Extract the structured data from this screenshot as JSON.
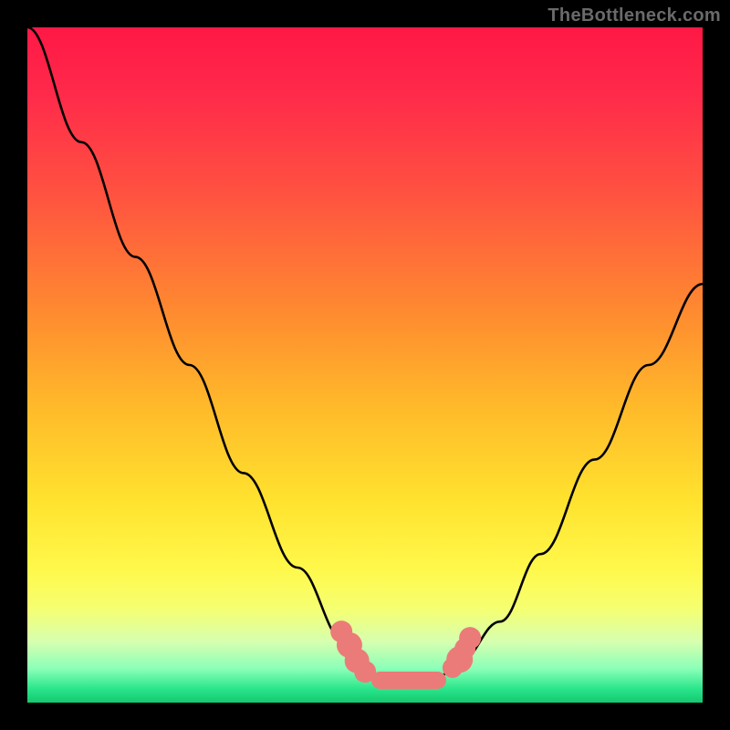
{
  "watermark": {
    "text": "TheBottleneck.com"
  },
  "colors": {
    "bead": "#eb7b78",
    "curve": "#000000",
    "frame": "#000000"
  },
  "chart_data": {
    "type": "line",
    "title": "",
    "xlabel": "",
    "ylabel": "",
    "xlim": [
      0,
      100
    ],
    "ylim": [
      0,
      100
    ],
    "grid": false,
    "legend": false,
    "series": [
      {
        "name": "bottleneck-curve",
        "x": [
          0,
          8,
          16,
          24,
          32,
          40,
          47,
          50,
          53,
          55,
          60,
          64,
          70,
          76,
          84,
          92,
          100
        ],
        "values": [
          100,
          83,
          66,
          50,
          34,
          20,
          9,
          5,
          3,
          3,
          3,
          6,
          12,
          22,
          36,
          50,
          62
        ]
      }
    ],
    "markers": [
      {
        "x": 46.5,
        "y": 10.5,
        "r": 1.6
      },
      {
        "x": 47.7,
        "y": 8.5,
        "r": 1.9
      },
      {
        "x": 48.8,
        "y": 6.2,
        "r": 1.8
      },
      {
        "x": 50.0,
        "y": 4.6,
        "r": 1.6
      },
      {
        "x": 63.0,
        "y": 5.2,
        "r": 1.5
      },
      {
        "x": 64.0,
        "y": 6.4,
        "r": 2.0
      },
      {
        "x": 64.8,
        "y": 8.0,
        "r": 1.6
      },
      {
        "x": 65.6,
        "y": 9.6,
        "r": 1.6
      }
    ],
    "floor_bar": {
      "x_start": 51,
      "x_end": 62,
      "y": 3.3,
      "thickness": 2.5
    }
  }
}
